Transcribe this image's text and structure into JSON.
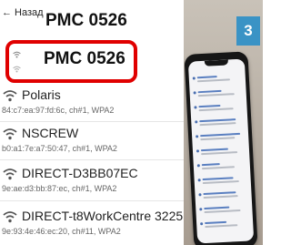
{
  "header": {
    "back_arrow": "←",
    "back_label": "Назад",
    "title": "PMC 0526"
  },
  "highlighted_network": {
    "ssid": "PMC 0526",
    "icon": "wifi-icon"
  },
  "networks": [
    {
      "ssid": "Polaris",
      "details": "84:c7:ea:97:fd:6c, ch#1, WPA2",
      "icon": "wifi-icon"
    },
    {
      "ssid": "NSCREW",
      "details": "b0:a1:7e:a7:50:47, ch#1, WPA2",
      "icon": "wifi-icon"
    },
    {
      "ssid": "DIRECT-D3BB07EC",
      "details": "9e:ae:d3:bb:87:ec, ch#1, WPA2",
      "icon": "wifi-icon"
    },
    {
      "ssid": "DIRECT-t8WorkCentre 3225",
      "details": "9e:93:4e:46:ec:20, ch#11, WPA2",
      "icon": "wifi-icon"
    }
  ],
  "step_badge": "3",
  "colors": {
    "highlight_border": "#e00000",
    "badge": "#3a93c5"
  }
}
